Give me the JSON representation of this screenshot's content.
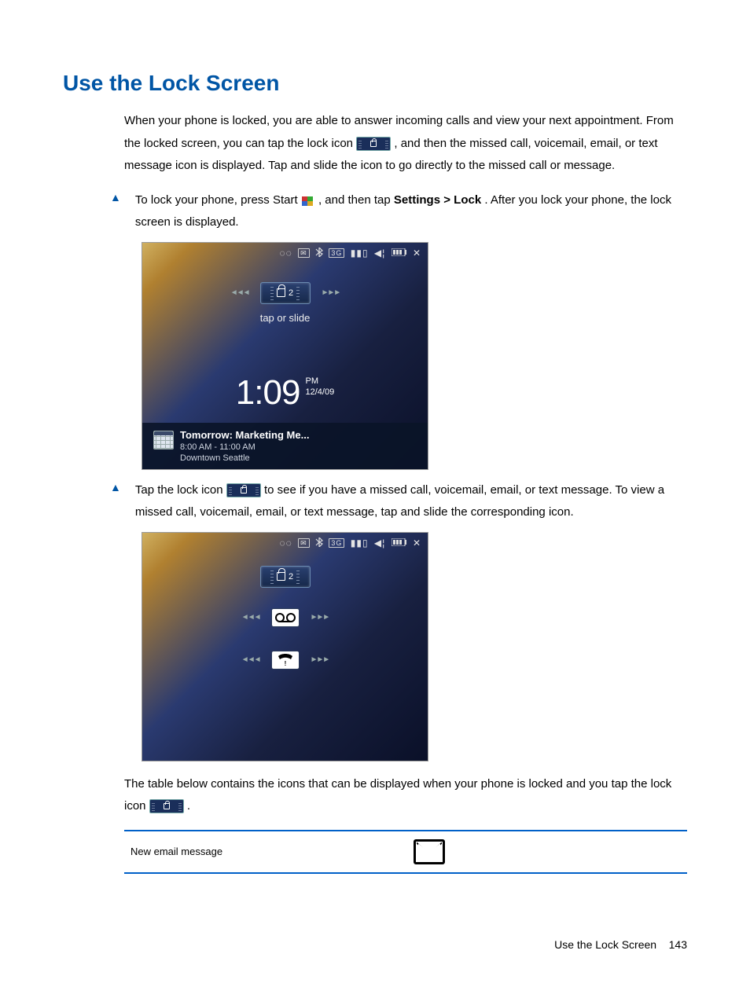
{
  "heading": "Use the Lock Screen",
  "intro_part1": "When your phone is locked, you are able to answer incoming calls and view your next appointment. From the locked screen, you can tap the lock icon ",
  "intro_part2": ", and then the missed call, voicemail, email, or text message icon is displayed. Tap and slide the icon to go directly to the missed call or message.",
  "bullet1_part1": "To lock your phone, press Start ",
  "bullet1_part2": ", and then tap ",
  "bullet1_bold": "Settings > Lock",
  "bullet1_part3": ". After you lock your phone, the lock screen is displayed.",
  "bullet2_part1": "Tap the lock icon ",
  "bullet2_part2": " to see if you have a missed call, voicemail, email, or text message. To view a missed call, voicemail, email, or text message, tap and slide the corresponding icon.",
  "screenshot1": {
    "slider_badge": "2",
    "tap_text": "tap or slide",
    "time": "1:09",
    "ampm": "PM",
    "date": "12/4/09",
    "appointment_title": "Tomorrow: Marketing Me...",
    "appointment_time": "8:00 AM - 11:00 AM",
    "appointment_location": "Downtown Seattle"
  },
  "screenshot2": {
    "slider_badge": "2"
  },
  "table_intro_part1": "The table below contains the icons that can be displayed when your phone is locked and you tap the lock icon ",
  "table_intro_part2": ".",
  "table_row1_label": "New email message",
  "footer_title": "Use the Lock Screen",
  "footer_page": "143"
}
